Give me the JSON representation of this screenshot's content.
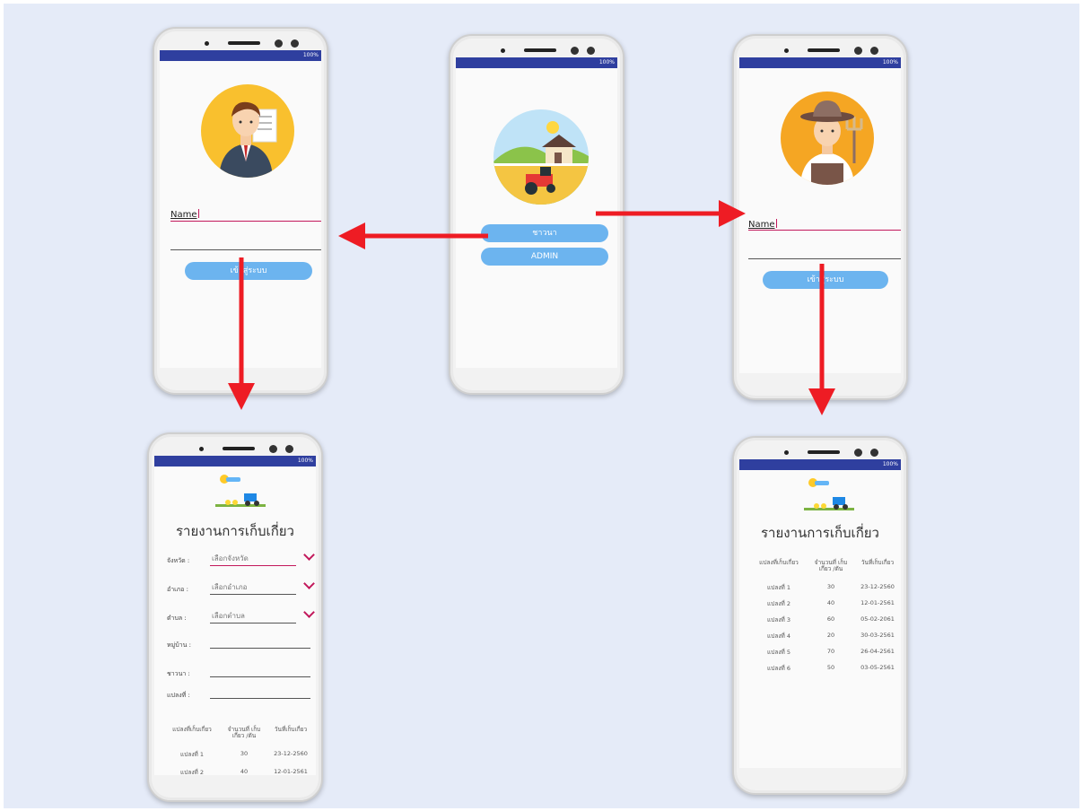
{
  "center_phone": {
    "status": {
      "left": "",
      "right": "100%"
    },
    "buttons": [
      "ชาวนา",
      "ADMIN"
    ]
  },
  "left_phone": {
    "status": {
      "left": "",
      "right": "100%"
    },
    "name_label": "Name",
    "login_button": "เข้าสู่ระบบ"
  },
  "right_phone": {
    "status": {
      "left": "",
      "right": "100%"
    },
    "name_label": "Name",
    "login_button": "เข้าสู่ระบบ"
  },
  "admin_report": {
    "status": {
      "left": "",
      "right": "100%"
    },
    "title": "รายงานการเก็บเกี่ยว",
    "fields": [
      {
        "label": "จังหวัด :",
        "placeholder": "เลือกจังหวัด"
      },
      {
        "label": "อำเภอ :",
        "placeholder": "เลือกอำเภอ"
      },
      {
        "label": "ตำบล :",
        "placeholder": "เลือกตำบล"
      },
      {
        "label": "หมู่บ้าน :",
        "placeholder": ""
      },
      {
        "label": "ชาวนา :",
        "placeholder": ""
      },
      {
        "label": "แปลงที่ :",
        "placeholder": ""
      }
    ],
    "table": {
      "headers": [
        "แปลงที่เก็บเกี่ยว",
        "จำนวนที่ เก็บ เกี่ยว /ตัน",
        "วันที่เก็บเกี่ยว"
      ],
      "rows": [
        [
          "แปลงที่ 1",
          "30",
          "23-12-2560"
        ],
        [
          "แปลงที่ 2",
          "40",
          "12-01-2561"
        ]
      ]
    }
  },
  "farmer_report": {
    "status": {
      "left": "",
      "right": "100%"
    },
    "title": "รายงานการเก็บเกี่ยว",
    "table": {
      "headers": [
        "แปลงที่เก็บเกี่ยว",
        "จำนวนที่ เก็บ เกี่ยว /ตัน",
        "วันที่เก็บเกี่ยว"
      ],
      "rows": [
        [
          "แปลงที่ 1",
          "30",
          "23-12-2560"
        ],
        [
          "แปลงที่ 2",
          "40",
          "12-01-2561"
        ],
        [
          "แปลงที่ 3",
          "60",
          "05-02-2061"
        ],
        [
          "แปลงที่ 4",
          "20",
          "30-03-2561"
        ],
        [
          "แปลงที่ 5",
          "70",
          "26-04-2561"
        ],
        [
          "แปลงที่ 6",
          "50",
          "03-05-2561"
        ]
      ]
    }
  },
  "colors": {
    "background": "#e5ebf8",
    "status_bar": "#2f3f9f",
    "button": "#6cb4ef",
    "arrow": "#ee1c24",
    "accent": "#c2185b"
  }
}
